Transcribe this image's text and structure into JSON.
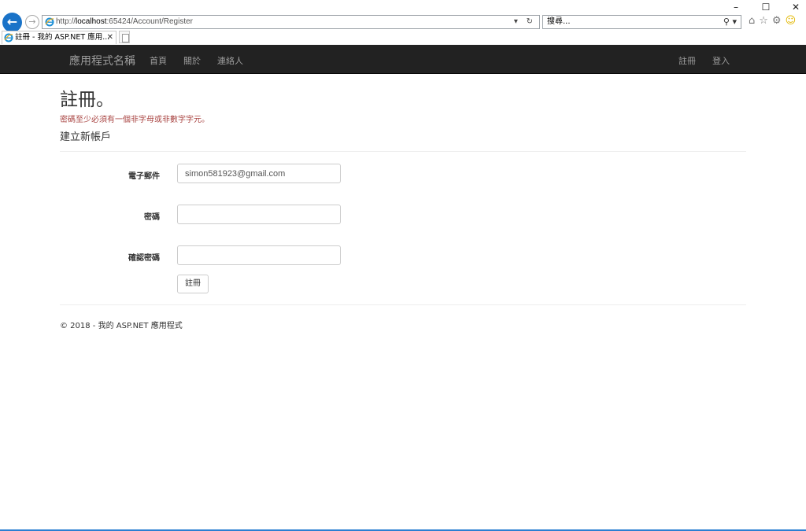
{
  "browser": {
    "window_controls": [
      "–",
      "☐",
      "✕"
    ],
    "address_prefix": "http://",
    "address_host": "localhost",
    "address_rest": ":65424/Account/Register",
    "address_tools": "▾ ↻",
    "search_placeholder": "搜尋...",
    "search_tools": "⚲ ▾",
    "tab_title": "註冊 - 我的 ASP.NET 應用...",
    "tab_close": "✕",
    "icons": [
      "home-icon",
      "favorites-star-icon",
      "settings-gear-icon",
      "feedback-smiley-icon"
    ]
  },
  "navbar": {
    "brand": "應用程式名稱",
    "left_links": [
      "首頁",
      "關於",
      "連絡人"
    ],
    "right_links": [
      "註冊",
      "登入"
    ]
  },
  "page": {
    "title": "註冊。",
    "validation_error": "密碼至少必須有一個非字母或非數字字元。",
    "subtitle": "建立新帳戶",
    "email_label": "電子郵件",
    "email_value": "simon581923@gmail.com",
    "password_label": "密碼",
    "password_value": "",
    "confirm_label": "確認密碼",
    "confirm_value": "",
    "submit_label": "註冊"
  },
  "footer": {
    "text": "© 2018 - 我的 ASP.NET 應用程式"
  },
  "colors": {
    "navbar_bg": "#222222",
    "nav_text": "#9d9d9d",
    "error_text": "#a94442",
    "accent": "#1a73c8"
  }
}
